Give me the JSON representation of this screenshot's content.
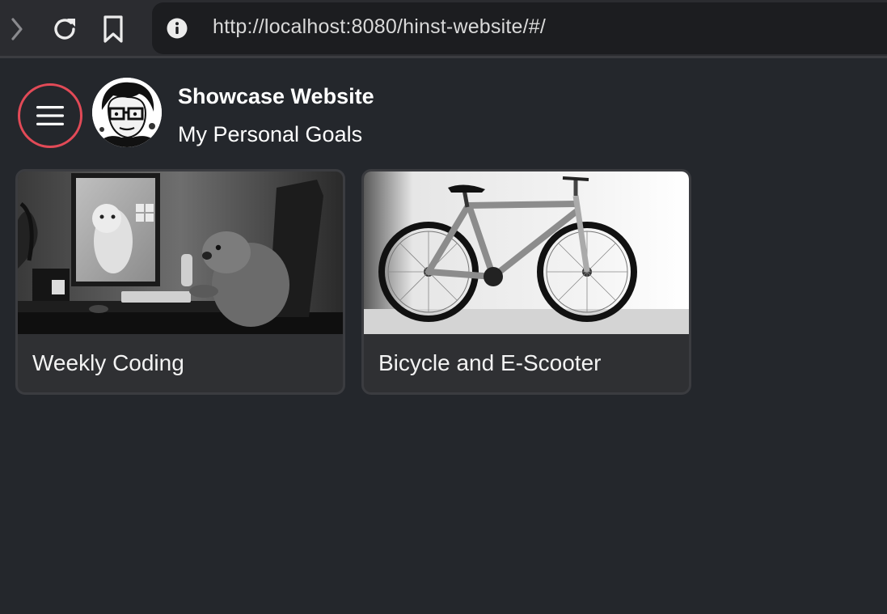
{
  "browser": {
    "url": "http://localhost:8080/hinst-website/#/",
    "icons": [
      "chevron-right-icon",
      "reload-icon",
      "bookmark-icon",
      "info-icon"
    ]
  },
  "header": {
    "menu_icon": "hamburger-menu-icon",
    "accent_color": "#e24a57",
    "title": "Showcase Website",
    "subtitle": "My Personal Goals"
  },
  "cards": [
    {
      "title": "Weekly Coding",
      "image": "beaver coding at a computer desk (grayscale photo)"
    },
    {
      "title": "Bicycle and E-Scooter",
      "image": "mountain bicycle against a white wall (grayscale photo)"
    }
  ],
  "colors": {
    "background": "#24272c",
    "card_background": "#2f3033",
    "card_border": "#3b3c40"
  }
}
